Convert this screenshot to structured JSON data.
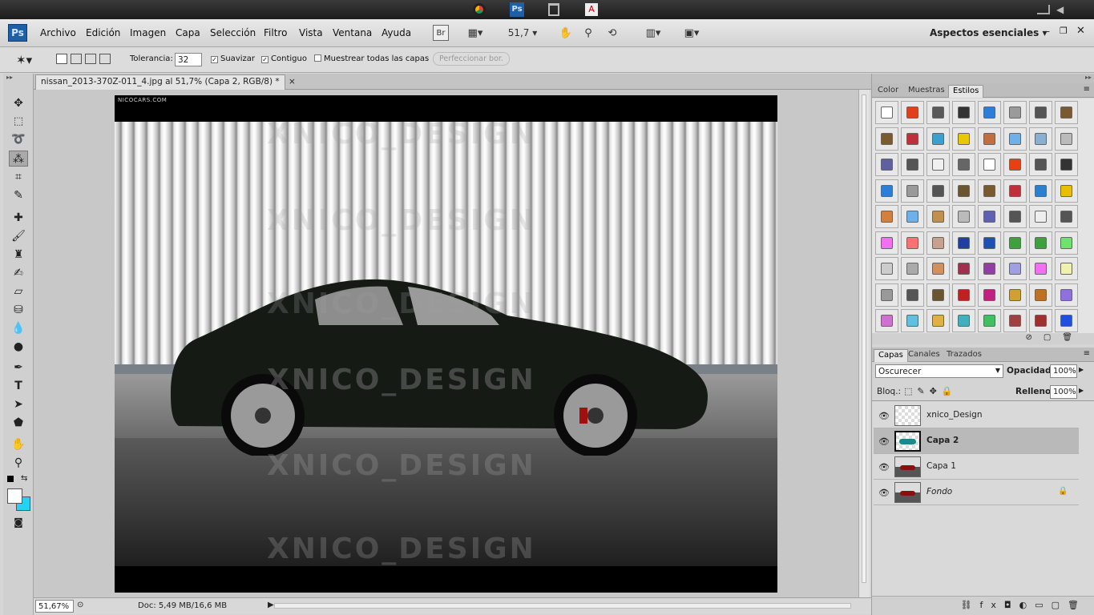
{
  "os_bar": {
    "taskbar_icons": [
      "chrome-icon",
      "photoshop-icon",
      "recycle-bin-icon",
      "acrobat-icon"
    ],
    "ps_label": "Ps"
  },
  "menu": {
    "app_logo": "Ps",
    "items": [
      "Archivo",
      "Edición",
      "Imagen",
      "Capa",
      "Selección",
      "Filtro",
      "Vista",
      "Ventana",
      "Ayuda"
    ],
    "bridge_btn": "Br",
    "zoom_value": "51,7",
    "workspace": "Aspectos esenciales"
  },
  "options": {
    "tolerance_label": "Tolerancia:",
    "tolerance_value": "32",
    "antialias_label": "Suavizar",
    "contiguous_label": "Contiguo",
    "sample_all_label": "Muestrear todas las capas",
    "refine_label": "Perfeccionar bor."
  },
  "document": {
    "tab_title": "nissan_2013-370Z-011_4.jpg al 51,7% (Capa 2, RGB/8) *",
    "close": "×",
    "watermark": "XNICO_DESIGN",
    "site_tag": "NICOCARS.COM"
  },
  "status": {
    "zoom": "51,67%",
    "doc_info": "Doc: 5,49 MB/16,6 MB"
  },
  "styles_panel": {
    "tabs": [
      "Color",
      "Muestras",
      "Estilos"
    ],
    "active": "Estilos",
    "swatch_colors": [
      "#ffffff",
      "#e0401a",
      "#5a5a5a",
      "#333",
      "#2b7fd6",
      "#9a9a9a",
      "#555",
      "#7a5a30",
      "#7a5a30",
      "#c0303a",
      "#3aa0d0",
      "#e8c800",
      "#c07040",
      "#70b0e8",
      "#8ab0d0",
      "#bbbbbb",
      "#6060a0",
      "#555",
      "#f0f0f0",
      "#666",
      "#ffffff",
      "#e84010",
      "#555",
      "#333",
      "#2b7fd6",
      "#9a9a9a",
      "#555",
      "#6a5530",
      "#7a5a30",
      "#c0303a",
      "#2b80d0",
      "#e8c000",
      "#d08040",
      "#70b0e8",
      "#c09050",
      "#bbbbbb",
      "#6060b0",
      "#555",
      "#eeeeee",
      "#555",
      "#f070f0",
      "#ff7070",
      "#c8a090",
      "#2040a0",
      "#2050b0",
      "#40a040",
      "#40a040",
      "#70e070",
      "#cccccc",
      "#aaaaaa",
      "#d09060",
      "#a03050",
      "#9040a0",
      "#a0a0e0",
      "#f070f0",
      "#f0f0b0",
      "#999999",
      "#555",
      "#6a5530",
      "#c02020",
      "#c02080",
      "#d0a030",
      "#c07020",
      "#9070e0",
      "#d070d0",
      "#60c0e0",
      "#e0b040",
      "#40b0c0",
      "#40c060",
      "#a04040",
      "#a03030",
      "#2050e0"
    ]
  },
  "layers_panel": {
    "tabs": [
      "Capas",
      "Canales",
      "Trazados"
    ],
    "active": "Capas",
    "blend_mode": "Oscurecer",
    "opacity_label": "Opacidad:",
    "opacity_value": "100%",
    "lock_label": "Bloq.:",
    "fill_label": "Relleno:",
    "fill_value": "100%",
    "layers": [
      {
        "name": "xnico_Design",
        "selected": false
      },
      {
        "name": "Capa 2",
        "selected": true
      },
      {
        "name": "Capa 1",
        "selected": false
      },
      {
        "name": "Fondo",
        "selected": false,
        "locked": true
      }
    ]
  }
}
